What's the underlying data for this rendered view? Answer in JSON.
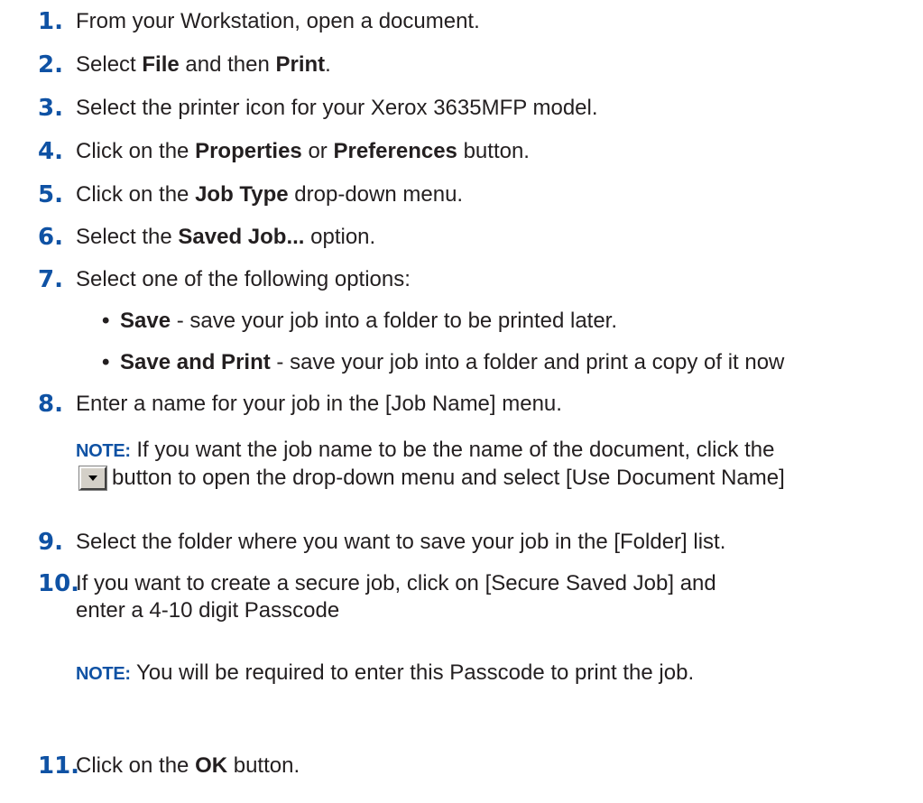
{
  "steps": [
    {
      "num": "1.",
      "text": "From your Workstation, open a document."
    },
    {
      "num": "2.",
      "pre": "Select ",
      "b1": "File",
      "mid": " and then ",
      "b2": "Print",
      "post": "."
    },
    {
      "num": "3.",
      "text": "Select the printer icon for your Xerox 3635MFP model."
    },
    {
      "num": "4.",
      "pre": "Click on the ",
      "b1": "Properties",
      "mid": " or ",
      "b2": "Preferences",
      "post": " button."
    },
    {
      "num": "5.",
      "pre": "Click on the ",
      "b1": "Job Type",
      "post": " drop-down menu."
    },
    {
      "num": "6.",
      "pre": "Select the ",
      "b1": "Saved Job...",
      "post": " option."
    },
    {
      "num": "7.",
      "text": "Select one of the following options:"
    },
    {
      "num": "8.",
      "text": "Enter a name for your job in the [Job Name] menu."
    },
    {
      "num": "9.",
      "text": "Select the folder where you want to save your job in the [Folder] list."
    },
    {
      "num": "10.",
      "line1": "If you want to create a secure job, click on [Secure Saved Job] and",
      "line2": "enter a 4-10 digit Passcode"
    },
    {
      "num": "11.",
      "pre": "Click on the ",
      "b1": "OK",
      "post": " button."
    }
  ],
  "bullets": [
    {
      "bold": "Save",
      "text": " - save your job into a folder to be printed later."
    },
    {
      "bold": "Save and Print",
      "text": " - save your job into a folder and print a copy of it now"
    }
  ],
  "note1": {
    "label": "NOTE:",
    "before": " If you want the job name to be the name of the document, click the",
    "after": "button to open the drop-down menu and select [Use Document Name]",
    "button_icon": "chevron-down-icon"
  },
  "note2": {
    "label": "NOTE:",
    "text": " You will be required to enter this Passcode to print the job."
  },
  "colors": {
    "accent": "#0f52a4",
    "text": "#231f20"
  }
}
